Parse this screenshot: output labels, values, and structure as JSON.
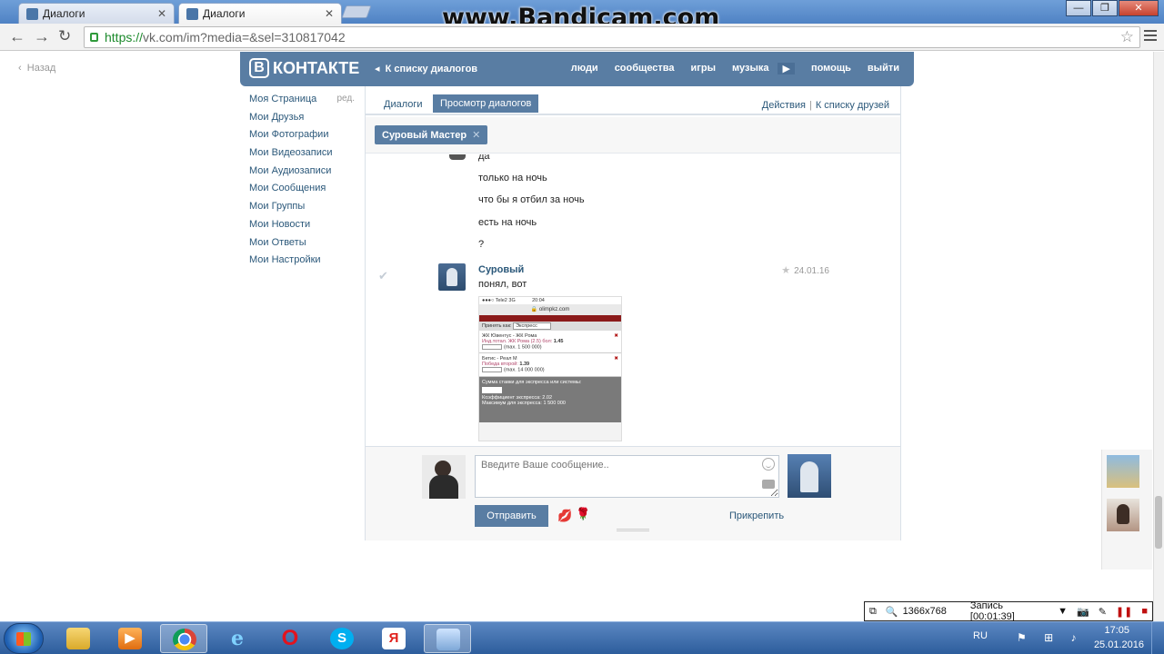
{
  "browser": {
    "tabs": [
      {
        "label": "Диалоги",
        "active": false
      },
      {
        "label": "Диалоги",
        "active": true
      }
    ],
    "tab_close": "✕",
    "url_scheme": "https://",
    "url_rest": "vk.com/im?media=&sel=310817042",
    "watermark": "www.Bandicam.com",
    "window_buttons": [
      "—",
      "❐",
      "✕"
    ]
  },
  "page": {
    "back_label": "Назад",
    "header": {
      "logo_letter": "В",
      "logo_text": "КОНТАКТЕ",
      "back_to_list": "К списку диалогов",
      "nav": [
        "люди",
        "сообщества",
        "игры",
        "музыка"
      ],
      "nav_more": "▶",
      "nav_right": [
        "помощь",
        "выйти"
      ]
    },
    "left_menu": {
      "items": [
        "Моя Страница",
        "Мои Друзья",
        "Мои Фотографии",
        "Мои Видеозаписи",
        "Мои Аудиозаписи",
        "Мои Сообщения",
        "Мои Группы",
        "Мои Новости",
        "Мои Ответы",
        "Мои Настройки"
      ],
      "edit_label": "ред."
    },
    "content_tabs": {
      "tabs": [
        "Диалоги",
        "Просмотр диалогов"
      ],
      "active_index": 1,
      "actions_label": "Действия",
      "friends_label": "К списку друзей",
      "separator": "|"
    },
    "peer_chip": {
      "name": "Суровый Мастер",
      "close": "✕"
    },
    "messages": {
      "previous_lines": [
        "да",
        "только на ночь",
        "что бы я отбил за ночь",
        "есть на ночь",
        "?"
      ],
      "last": {
        "author": "Суровый",
        "date": "24.01.16",
        "text": "понял, вот"
      }
    },
    "photo": {
      "status_carrier": "●●●○ Tele2  3G",
      "status_time": "20:04",
      "url": "🔒 olimpkz.com",
      "accept_label": "Принять как:",
      "accept_value": "Экспресс",
      "bets": [
        {
          "match": "ЖК Ювентус - ЖК Рома",
          "market": "Инд.тотал. ЖК Рома (2.5) бол:",
          "odds": "1.45",
          "max": "(max. 1 500 000)"
        },
        {
          "match": "Бетис - Реал М",
          "market": "Победа второй:",
          "odds": "1.39",
          "max": "(max. 14 000 000)"
        }
      ],
      "sum_label": "Сумма ставки для экспресса или системы:",
      "coef_label": "Коэффициент экспресса:",
      "coef_value": "2.02",
      "max_label": "Максимум для экспресса:",
      "max_value": "1 500 000"
    },
    "composer": {
      "placeholder": "Введите Ваше сообщение..",
      "send_label": "Отправить",
      "attach_label": "Прикрепить"
    }
  },
  "recorder": {
    "resolution": "1366x768",
    "recording": "Запись [00:01:39]"
  },
  "taskbar": {
    "apps": [
      "explorer",
      "media-player",
      "chrome",
      "ie",
      "opera",
      "skype",
      "yandex",
      "control-panel"
    ],
    "skype_letter": "S",
    "yandex_letter": "Я",
    "opera_letter": "O",
    "lang": "RU",
    "time": "17:05",
    "date": "25.01.2016"
  }
}
